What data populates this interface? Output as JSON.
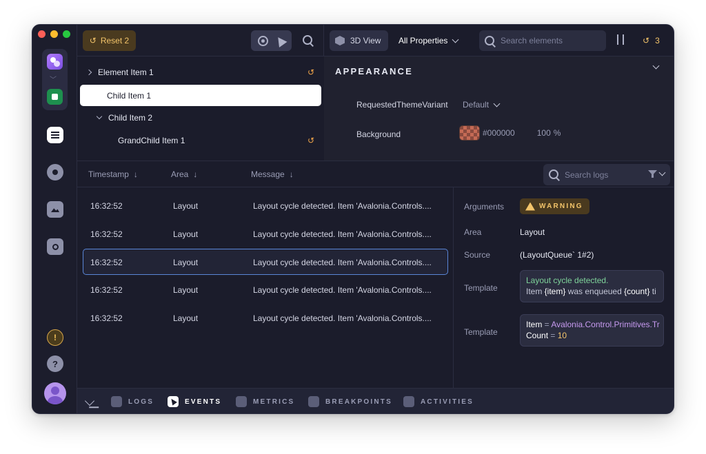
{
  "toolbar": {
    "reset_label": "Reset 2",
    "view_3d_label": "3D View",
    "properties_filter": "All Properties",
    "search_elements_placeholder": "Search elements",
    "undo_count": "3"
  },
  "tree": {
    "items": [
      {
        "label": "Element Item 1",
        "expander": "collapsed",
        "modified": true
      },
      {
        "label": "Child Item 1",
        "selected": true
      },
      {
        "label": "Child Item 2",
        "expander": "expanded"
      },
      {
        "label": "GrandChild Item 1",
        "modified": true
      }
    ]
  },
  "properties": {
    "section_title": "APPEARANCE",
    "rows": [
      {
        "label": "RequestedThemeVariant",
        "value": "Default"
      },
      {
        "label": "Background",
        "value": "#000000",
        "opacity": "100",
        "unit": "%"
      }
    ]
  },
  "log_columns": {
    "timestamp": "Timestamp",
    "area": "Area",
    "message": "Message",
    "search_placeholder": "Search logs"
  },
  "logs": [
    {
      "time": "16:32:52",
      "area": "Layout",
      "message": "Layout cycle detected. Item 'Avalonia.Controls...."
    },
    {
      "time": "16:32:52",
      "area": "Layout",
      "message": "Layout cycle detected. Item 'Avalonia.Controls...."
    },
    {
      "time": "16:32:52",
      "area": "Layout",
      "message": "Layout cycle detected. Item 'Avalonia.Controls...."
    },
    {
      "time": "16:32:52",
      "area": "Layout",
      "message": "Layout cycle detected. Item 'Avalonia.Controls...."
    },
    {
      "time": "16:32:52",
      "area": "Layout",
      "message": "Layout cycle detected. Item 'Avalonia.Controls...."
    }
  ],
  "details": {
    "arguments_label": "Arguments",
    "level_badge": "WARNING",
    "area_label": "Area",
    "area_value": "Layout",
    "source_label": "Source",
    "source_value": "(LayoutQueue` 1#2)",
    "template_label": "Template",
    "template_line1": "Layout cycle detected.",
    "template_line2_a": "Item ",
    "template_line2_b": "{item}",
    "template_line2_c": " was enqueued ",
    "template_line2_d": "{count}",
    "template_line2_e": " ti",
    "template2_label": "Template",
    "item_key": "Item",
    "item_eq": " = ",
    "item_value": "Avalonia.Control.Primitives.Tr",
    "count_key": "Count",
    "count_eq": " = ",
    "count_value": "10"
  },
  "bottom_tabs": [
    {
      "label": "LOGS",
      "icon": "logs-icon"
    },
    {
      "label": "EVENTS",
      "icon": "cursor-icon",
      "active": true
    },
    {
      "label": "METRICS",
      "icon": "metrics-icon"
    },
    {
      "label": "BREAKPOINTS",
      "icon": "lightning-icon"
    },
    {
      "label": "ACTIVITIES",
      "icon": "pulse-icon"
    }
  ],
  "colors": {
    "background": "#1b1c2b",
    "accent_warning": "#f3c46a",
    "selection_border": "#5a86d8"
  }
}
